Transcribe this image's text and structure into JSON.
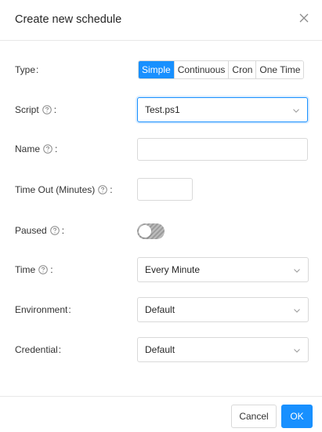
{
  "dialog": {
    "title": "Create new schedule"
  },
  "form": {
    "type": {
      "label": "Type",
      "colon": ":",
      "options": [
        "Simple",
        "Continuous",
        "Cron",
        "One Time"
      ],
      "selected": "Simple"
    },
    "script": {
      "label": "Script",
      "colon": ":",
      "value": "Test.ps1"
    },
    "name": {
      "label": "Name",
      "colon": ":",
      "value": ""
    },
    "timeout": {
      "label": "Time Out (Minutes)",
      "colon": ":",
      "value": ""
    },
    "paused": {
      "label": "Paused",
      "colon": ":",
      "checked": false
    },
    "time": {
      "label": "Time",
      "colon": ":",
      "value": "Every Minute"
    },
    "environment": {
      "label": "Environment",
      "colon": ":",
      "value": "Default"
    },
    "credential": {
      "label": "Credential",
      "colon": ":",
      "value": "Default"
    }
  },
  "footer": {
    "cancel_label": "Cancel",
    "ok_label": "OK"
  },
  "colors": {
    "primary": "#1890ff",
    "border": "#d9d9d9",
    "toggle_off": "#a8a8a8"
  }
}
